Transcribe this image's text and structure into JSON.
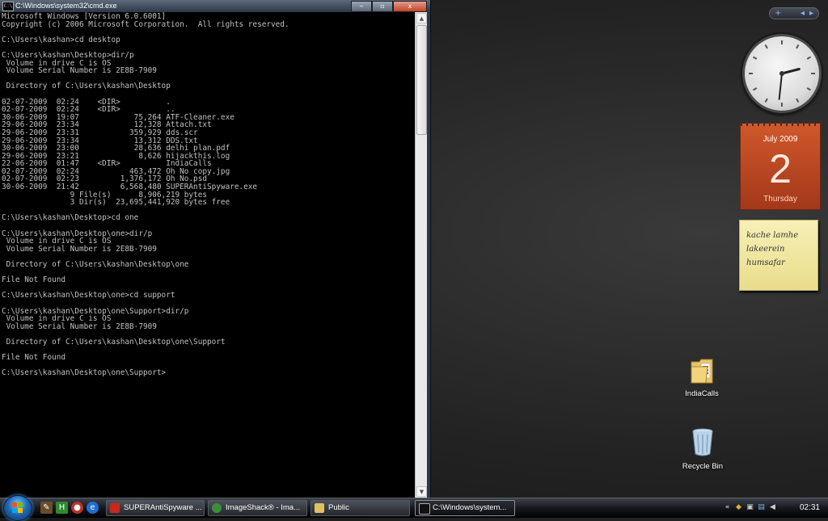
{
  "cmd_window": {
    "title": "C:\\Windows\\system32\\cmd.exe",
    "app_icon_label": "C:\\",
    "minimize_glyph": "‒",
    "maximize_glyph": "▫",
    "close_glyph": "x",
    "console_text": "Microsoft Windows [Version 6.0.6001]\nCopyright (c) 2006 Microsoft Corporation.  All rights reserved.\n\nC:\\Users\\kashan>cd desktop\n\nC:\\Users\\kashan\\Desktop>dir/p\n Volume in drive C is OS\n Volume Serial Number is 2E8B-7909\n\n Directory of C:\\Users\\kashan\\Desktop\n\n02-07-2009  02:24    <DIR>          .\n02-07-2009  02:24    <DIR>          ..\n30-06-2009  19:07            75,264 ATF-Cleaner.exe\n29-06-2009  23:34            12,328 Attach.txt\n29-06-2009  23:31           359,929 dds.scr\n29-06-2009  23:34            13,312 DDS.txt\n30-06-2009  23:00            28,636 delhi plan.pdf\n29-06-2009  23:21             8,626 hijackthis.log\n22-06-2009  01:47    <DIR>          IndiaCalls\n02-07-2009  02:24           463,472 Oh No copy.jpg\n02-07-2009  02:23         1,376,172 Oh No.psd\n30-06-2009  21:42         6,568,480 SUPERAntiSpyware.exe\n               9 File(s)      8,906,219 bytes\n               3 Dir(s)  23,695,441,920 bytes free\n\nC:\\Users\\kashan\\Desktop>cd one\n\nC:\\Users\\kashan\\Desktop\\one>dir/p\n Volume in drive C is OS\n Volume Serial Number is 2E8B-7909\n\n Directory of C:\\Users\\kashan\\Desktop\\one\n\nFile Not Found\n\nC:\\Users\\kashan\\Desktop\\one>cd support\n\nC:\\Users\\kashan\\Desktop\\one\\Support>dir/p\n Volume in drive C is OS\n Volume Serial Number is 2E8B-7909\n\n Directory of C:\\Users\\kashan\\Desktop\\one\\Support\n\nFile Not Found\n\nC:\\Users\\kashan\\Desktop\\one\\Support>"
  },
  "gadgets": {
    "controls": {
      "add": "+",
      "prev": "◂",
      "next": "▸"
    },
    "clock": {
      "hour": 2,
      "minute": 31
    },
    "calendar": {
      "month": "July 2009",
      "day": "2",
      "weekday": "Thursday"
    },
    "note": {
      "lines": [
        "kache lamhe",
        "lakeerein",
        "humsafar"
      ]
    }
  },
  "desktop_icons": [
    {
      "label": "IndiaCalls",
      "icon": "folder-icon"
    },
    {
      "label": "Recycle Bin",
      "icon": "recycle-bin-icon"
    }
  ],
  "taskbar": {
    "tasks": [
      {
        "label": "SUPERAntiSpyware ...",
        "icon": "superantispyware-icon",
        "color": "#c8281e"
      },
      {
        "label": "ImageShack® - Ima...",
        "icon": "chrome-icon",
        "color": "#3e8e3a"
      },
      {
        "label": "Public",
        "icon": "folder-icon",
        "color": "#e3c060"
      },
      {
        "label": "C:\\Windows\\system...",
        "icon": "cmd-icon",
        "color": "#222222"
      }
    ],
    "time": "02:31"
  }
}
